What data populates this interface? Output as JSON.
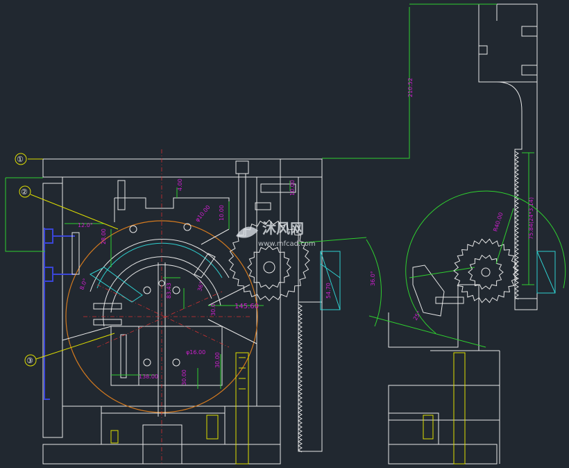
{
  "colors": {
    "background": "#212830",
    "outline": "#e8e8e8",
    "dimension_line": "#2fd12f",
    "dimension_text": "#d21fd2",
    "leader": "#e0e000",
    "pitch_circle": "#d47a1f",
    "centerline": "#d43030",
    "hidden_line": "#2fd0d0",
    "blue_line": "#3a46d8"
  },
  "balloons": [
    "①",
    "②",
    "③"
  ],
  "dimensions": {
    "d_210_52": "210.52",
    "d_4_00": "4.00",
    "d_10_00_a": "10.00",
    "d_10_00_b": "10.00",
    "d_phi10": "φ10.00",
    "d_12_0": "12.0°",
    "d_28_00": "28.00",
    "d_8_0": "8.0°",
    "d_145_60": "145.60",
    "d_83_43": "83.43",
    "d_36_0": "36.0°",
    "d_54_70": "54.70",
    "d_138_00": "138.00",
    "d_30_00_a": "30.00",
    "d_30_00_b": "30.00",
    "d_phi16": "φ16.00",
    "d_r40": "R40.00",
    "d_75_84": "75.84(24*3.14)",
    "d_25": "25°",
    "d_36": "36°",
    "d_side": "30.0"
  },
  "watermark": {
    "brand": "沐风网",
    "url": "www.mfcad.com"
  }
}
